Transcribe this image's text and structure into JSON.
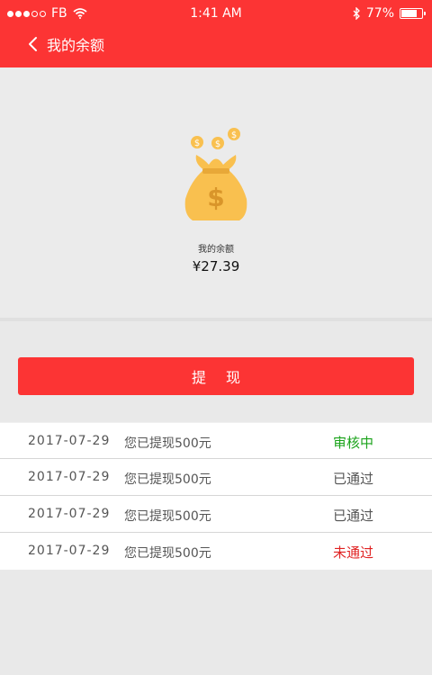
{
  "status_bar": {
    "carrier": "FB",
    "time": "1:41 AM",
    "battery": "77%",
    "battery_level": 0.77
  },
  "nav": {
    "title": "我的余额"
  },
  "balance": {
    "label": "我的余额",
    "amount": "¥27.39"
  },
  "withdraw_button": "提现",
  "records": [
    {
      "date": "2017-07-29",
      "desc": "您已提现500元",
      "status": "审核中",
      "state": "pending"
    },
    {
      "date": "2017-07-29",
      "desc": "您已提现500元",
      "status": "已通过",
      "state": "approved"
    },
    {
      "date": "2017-07-29",
      "desc": "您已提现500元",
      "status": "已通过",
      "state": "approved"
    },
    {
      "date": "2017-07-29",
      "desc": "您已提现500元",
      "status": "未通过",
      "state": "rejected"
    }
  ],
  "colors": {
    "brand_red": "#fc3434",
    "pending_green": "#1aa31a",
    "rejected_red": "#e02222",
    "bag_yellow": "#f9c04f"
  },
  "icons": [
    "wifi-icon",
    "bluetooth-icon",
    "battery-icon",
    "back-chevron-icon",
    "money-bag-icon"
  ]
}
